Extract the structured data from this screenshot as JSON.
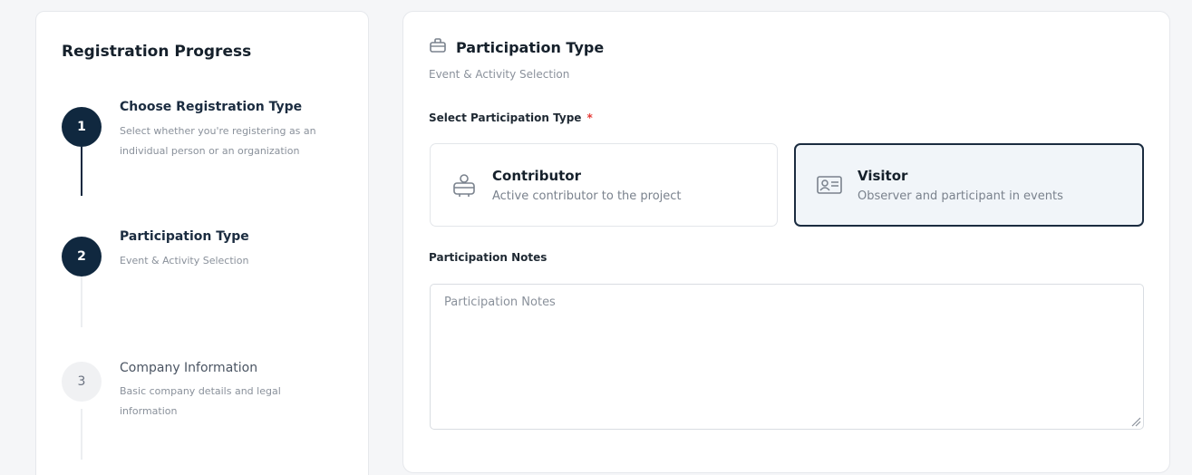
{
  "progress": {
    "title": "Registration Progress",
    "steps": [
      {
        "number": "1",
        "title": "Choose Registration Type",
        "description": "Select whether you're registering as an individual person or an organization",
        "state": "completed"
      },
      {
        "number": "2",
        "title": "Participation Type",
        "description": "Event & Activity Selection",
        "state": "current"
      },
      {
        "number": "3",
        "title": "Company Information",
        "description": "Basic company details and legal information",
        "state": "upcoming"
      }
    ]
  },
  "form": {
    "section_icon": "briefcase-icon",
    "section_title": "Participation Type",
    "section_subtitle": "Event & Activity Selection",
    "participation_label": "Select Participation Type",
    "required_marker": "*",
    "options": [
      {
        "icon": "contributor-icon",
        "title": "Contributor",
        "description": "Active contributor to the project",
        "selected": false
      },
      {
        "icon": "id-card-icon",
        "title": "Visitor",
        "description": "Observer and participant in events",
        "selected": true
      }
    ],
    "notes_label": "Participation Notes",
    "notes_placeholder": "Participation Notes",
    "notes_value": ""
  },
  "colors": {
    "primary": "#10283f",
    "required": "#e53935",
    "selected_bg": "#f1f5f9"
  }
}
